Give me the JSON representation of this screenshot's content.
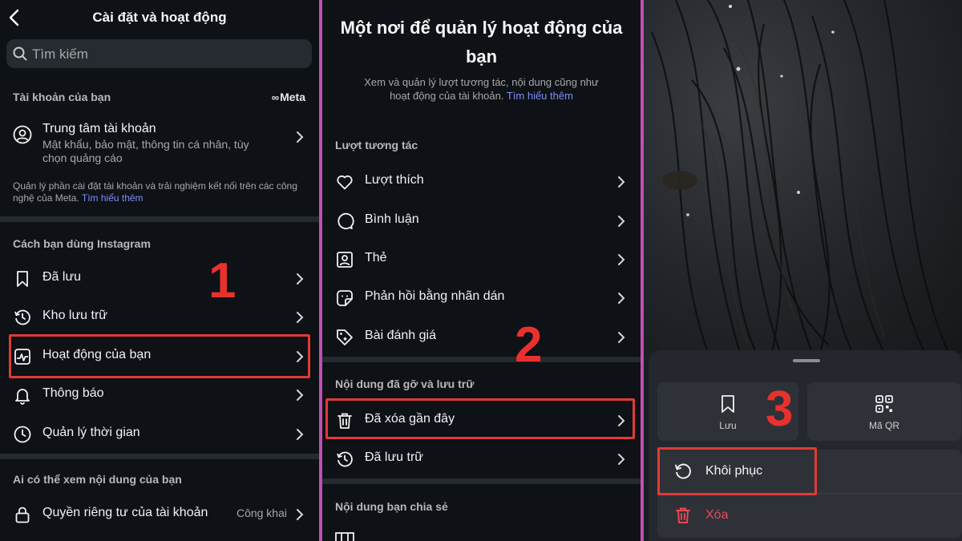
{
  "panel1": {
    "title": "Cài đặt và hoạt động",
    "search_placeholder": "Tìm kiếm",
    "section_account": "Tài khoản của bạn",
    "meta_brand": "Meta",
    "account_center": {
      "title": "Trung tâm tài khoản",
      "subtitle": "Mật khẩu, bảo mật, thông tin cá nhân, tùy chọn quảng cáo"
    },
    "note_text": "Quản lý phần cài đặt tài khoản và trải nghiệm kết nối trên các công nghệ của Meta.",
    "note_link": "Tìm hiểu thêm",
    "section_usage": "Cách bạn dùng Instagram",
    "usage_items": [
      "Đã lưu",
      "Kho lưu trữ",
      "Hoạt động của bạn",
      "Thông báo",
      "Quản lý thời gian"
    ],
    "section_privacy": "Ai có thể xem nội dung của bạn",
    "privacy_item": {
      "label": "Quyền riêng tư của tài khoản",
      "value": "Công khai"
    },
    "step": "1"
  },
  "panel2": {
    "title": "Một nơi để quản lý hoạt động của bạn",
    "desc": "Xem và quản lý lượt tương tác, nội dung cũng như hoạt động của tài khoản.",
    "desc_link": "Tìm hiểu thêm",
    "section_interactions": "Lượt tương tác",
    "interaction_items": [
      "Lượt thích",
      "Bình luận",
      "Thẻ",
      "Phản hồi bằng nhãn dán",
      "Bài đánh giá"
    ],
    "section_removed": "Nội dung đã gỡ và lưu trữ",
    "removed_items": [
      "Đã xóa gần đây",
      "Đã lưu trữ"
    ],
    "section_shared": "Nội dung bạn chia sẻ",
    "step": "2"
  },
  "panel3": {
    "tile_save": "Lưu",
    "tile_qr": "Mã QR",
    "restore": "Khôi phục",
    "delete": "Xóa",
    "step": "3"
  },
  "colors": {
    "background": "#0e1116",
    "highlight": "#e03a36",
    "link": "#7d8ff5",
    "divider": "#c04fb5",
    "delete_red": "#ed4956"
  }
}
